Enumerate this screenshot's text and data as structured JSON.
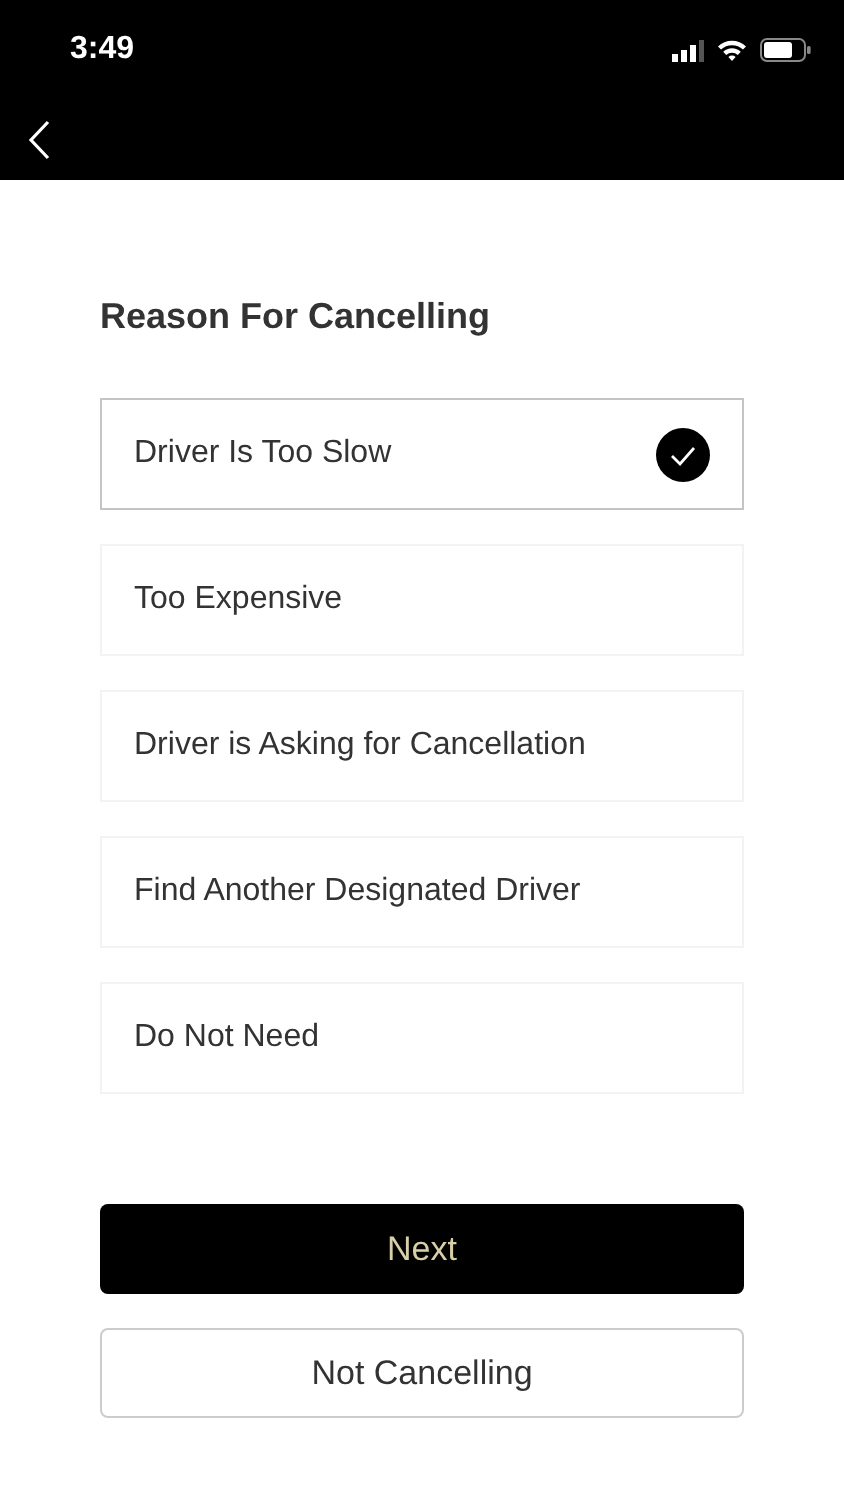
{
  "status_bar": {
    "time": "3:49"
  },
  "title": "Reason For Cancelling",
  "reasons": [
    {
      "label": "Driver Is Too Slow",
      "selected": true
    },
    {
      "label": "Too Expensive",
      "selected": false
    },
    {
      "label": "Driver is Asking for Cancellation",
      "selected": false
    },
    {
      "label": "Find Another Designated Driver",
      "selected": false
    },
    {
      "label": "Do Not Need",
      "selected": false
    }
  ],
  "buttons": [
    {
      "label": "Next",
      "kind": "primary"
    },
    {
      "label": "Not Cancelling",
      "kind": "secondary"
    }
  ]
}
